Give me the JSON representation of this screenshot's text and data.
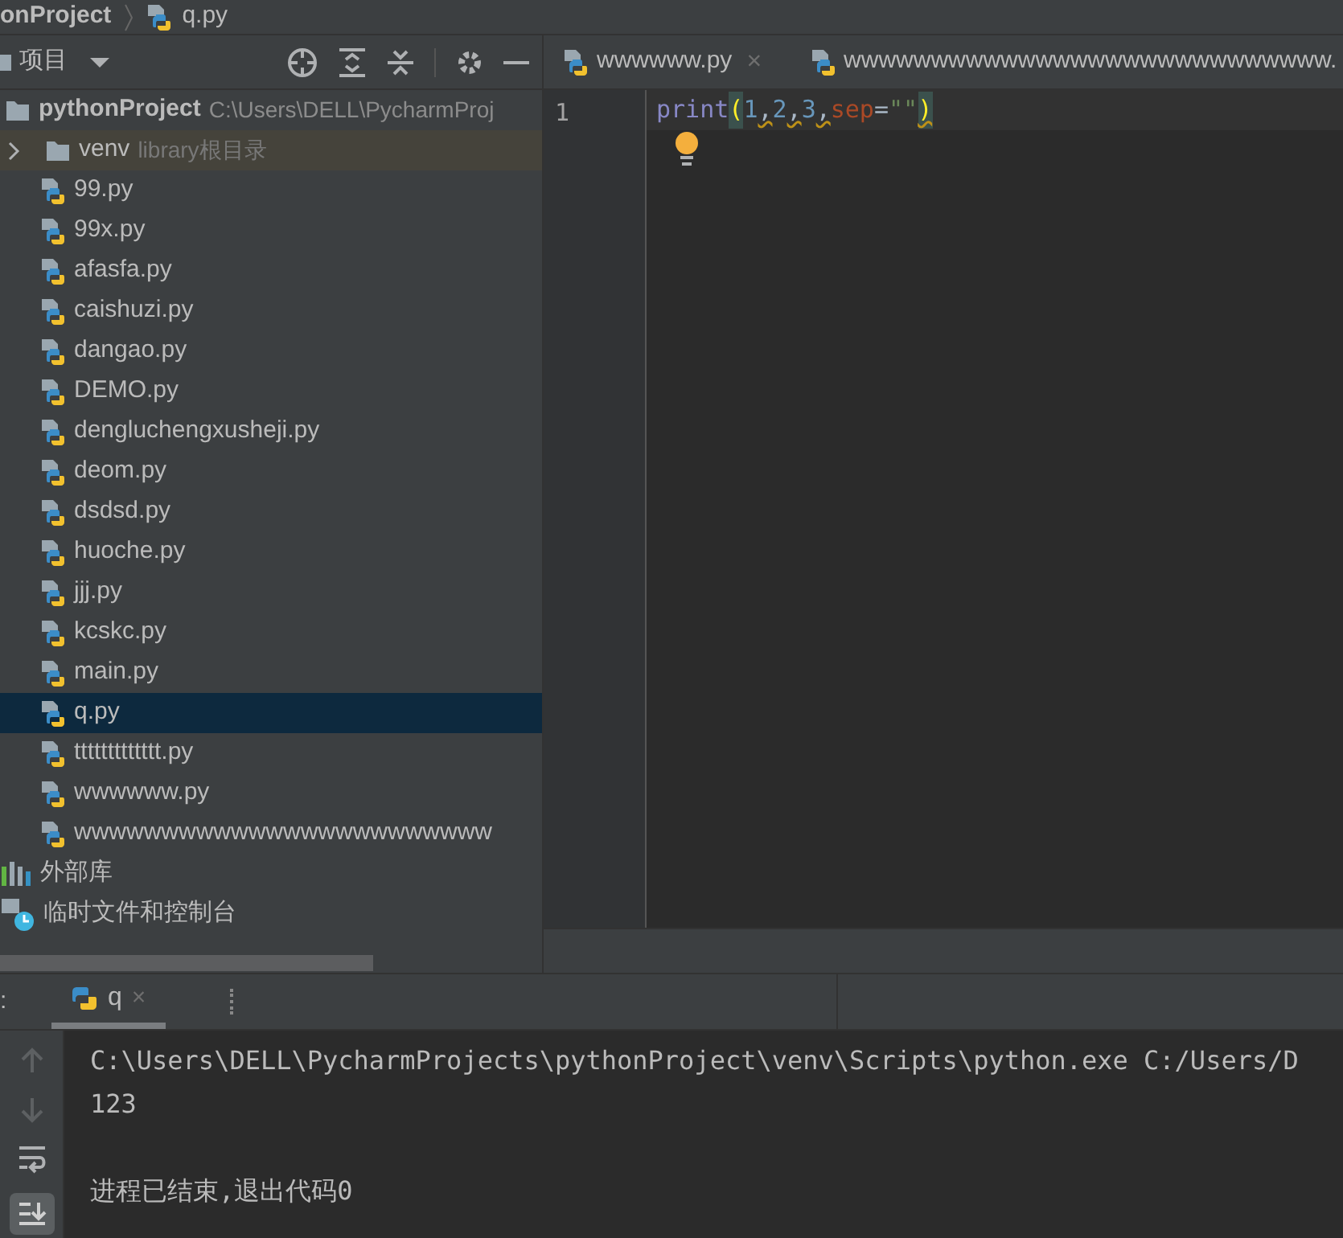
{
  "breadcrumb": [
    "onProject",
    "q.py"
  ],
  "project_panel": {
    "title": "项目",
    "root": {
      "name": "pythonProject",
      "path": "C:\\Users\\DELL\\PycharmProj",
      "children": [
        {
          "name": "venv",
          "hint": "library根目录",
          "kind": "folder",
          "expanded": false,
          "selected": false
        },
        {
          "name": "99.py",
          "kind": "python",
          "selected": false
        },
        {
          "name": "99x.py",
          "kind": "python",
          "selected": false
        },
        {
          "name": "afasfa.py",
          "kind": "python",
          "selected": false
        },
        {
          "name": "caishuzi.py",
          "kind": "python",
          "selected": false
        },
        {
          "name": "dangao.py",
          "kind": "python",
          "selected": false
        },
        {
          "name": "DEMO.py",
          "kind": "python",
          "selected": false
        },
        {
          "name": "dengluchengxusheji.py",
          "kind": "python",
          "selected": false
        },
        {
          "name": "deom.py",
          "kind": "python",
          "selected": false
        },
        {
          "name": "dsdsd.py",
          "kind": "python",
          "selected": false
        },
        {
          "name": "huoche.py",
          "kind": "python",
          "selected": false
        },
        {
          "name": "jjj.py",
          "kind": "python",
          "selected": false
        },
        {
          "name": "kcskc.py",
          "kind": "python",
          "selected": false
        },
        {
          "name": "main.py",
          "kind": "python",
          "selected": false
        },
        {
          "name": "q.py",
          "kind": "python",
          "selected": true
        },
        {
          "name": "ttttttttttttt.py",
          "kind": "python",
          "selected": false
        },
        {
          "name": "wwwwww.py",
          "kind": "python",
          "selected": false
        },
        {
          "name": "wwwwwwwwwwwwwwwwwwwwwwww",
          "kind": "python",
          "selected": false
        }
      ]
    },
    "others": [
      {
        "name": "外部库",
        "kind": "libraries"
      },
      {
        "name": "临时文件和控制台",
        "kind": "scratches"
      }
    ]
  },
  "editor_tabs": [
    {
      "label": "wwwwww.py",
      "close": "×"
    },
    {
      "label": "wwwwwwwwwwwwwwwwwwwwwwwwwwww."
    }
  ],
  "editor": {
    "line_number": "1",
    "tokens": [
      {
        "text": "print",
        "kind": "builtin",
        "warning": false
      },
      {
        "text": "(",
        "kind": "paren",
        "warning": false
      },
      {
        "text": "1",
        "kind": "number",
        "warning": false
      },
      {
        "text": ",",
        "kind": "plain",
        "warning": true
      },
      {
        "text": "2",
        "kind": "number",
        "warning": false
      },
      {
        "text": ",",
        "kind": "plain",
        "warning": true
      },
      {
        "text": "3",
        "kind": "number",
        "warning": false
      },
      {
        "text": ",",
        "kind": "plain",
        "warning": true
      },
      {
        "text": "sep",
        "kind": "keyword_arg",
        "warning": false
      },
      {
        "text": "=",
        "kind": "plain",
        "warning": false
      },
      {
        "text": "\"\"",
        "kind": "string",
        "warning": false
      },
      {
        "text": ")",
        "kind": "paren",
        "warning": true
      }
    ]
  },
  "run_panel": {
    "label": ":",
    "tab": {
      "label": "q",
      "close": "×",
      "selected": true
    },
    "output": [
      {
        "text": "C:\\Users\\DELL\\PycharmProjects\\pythonProject\\venv\\Scripts\\python.exe C:/Users/D",
        "kind": "command"
      },
      {
        "text": "123",
        "kind": "stdout"
      },
      {
        "text": "进程已结束,退出代码0",
        "kind": "exit"
      }
    ]
  }
}
